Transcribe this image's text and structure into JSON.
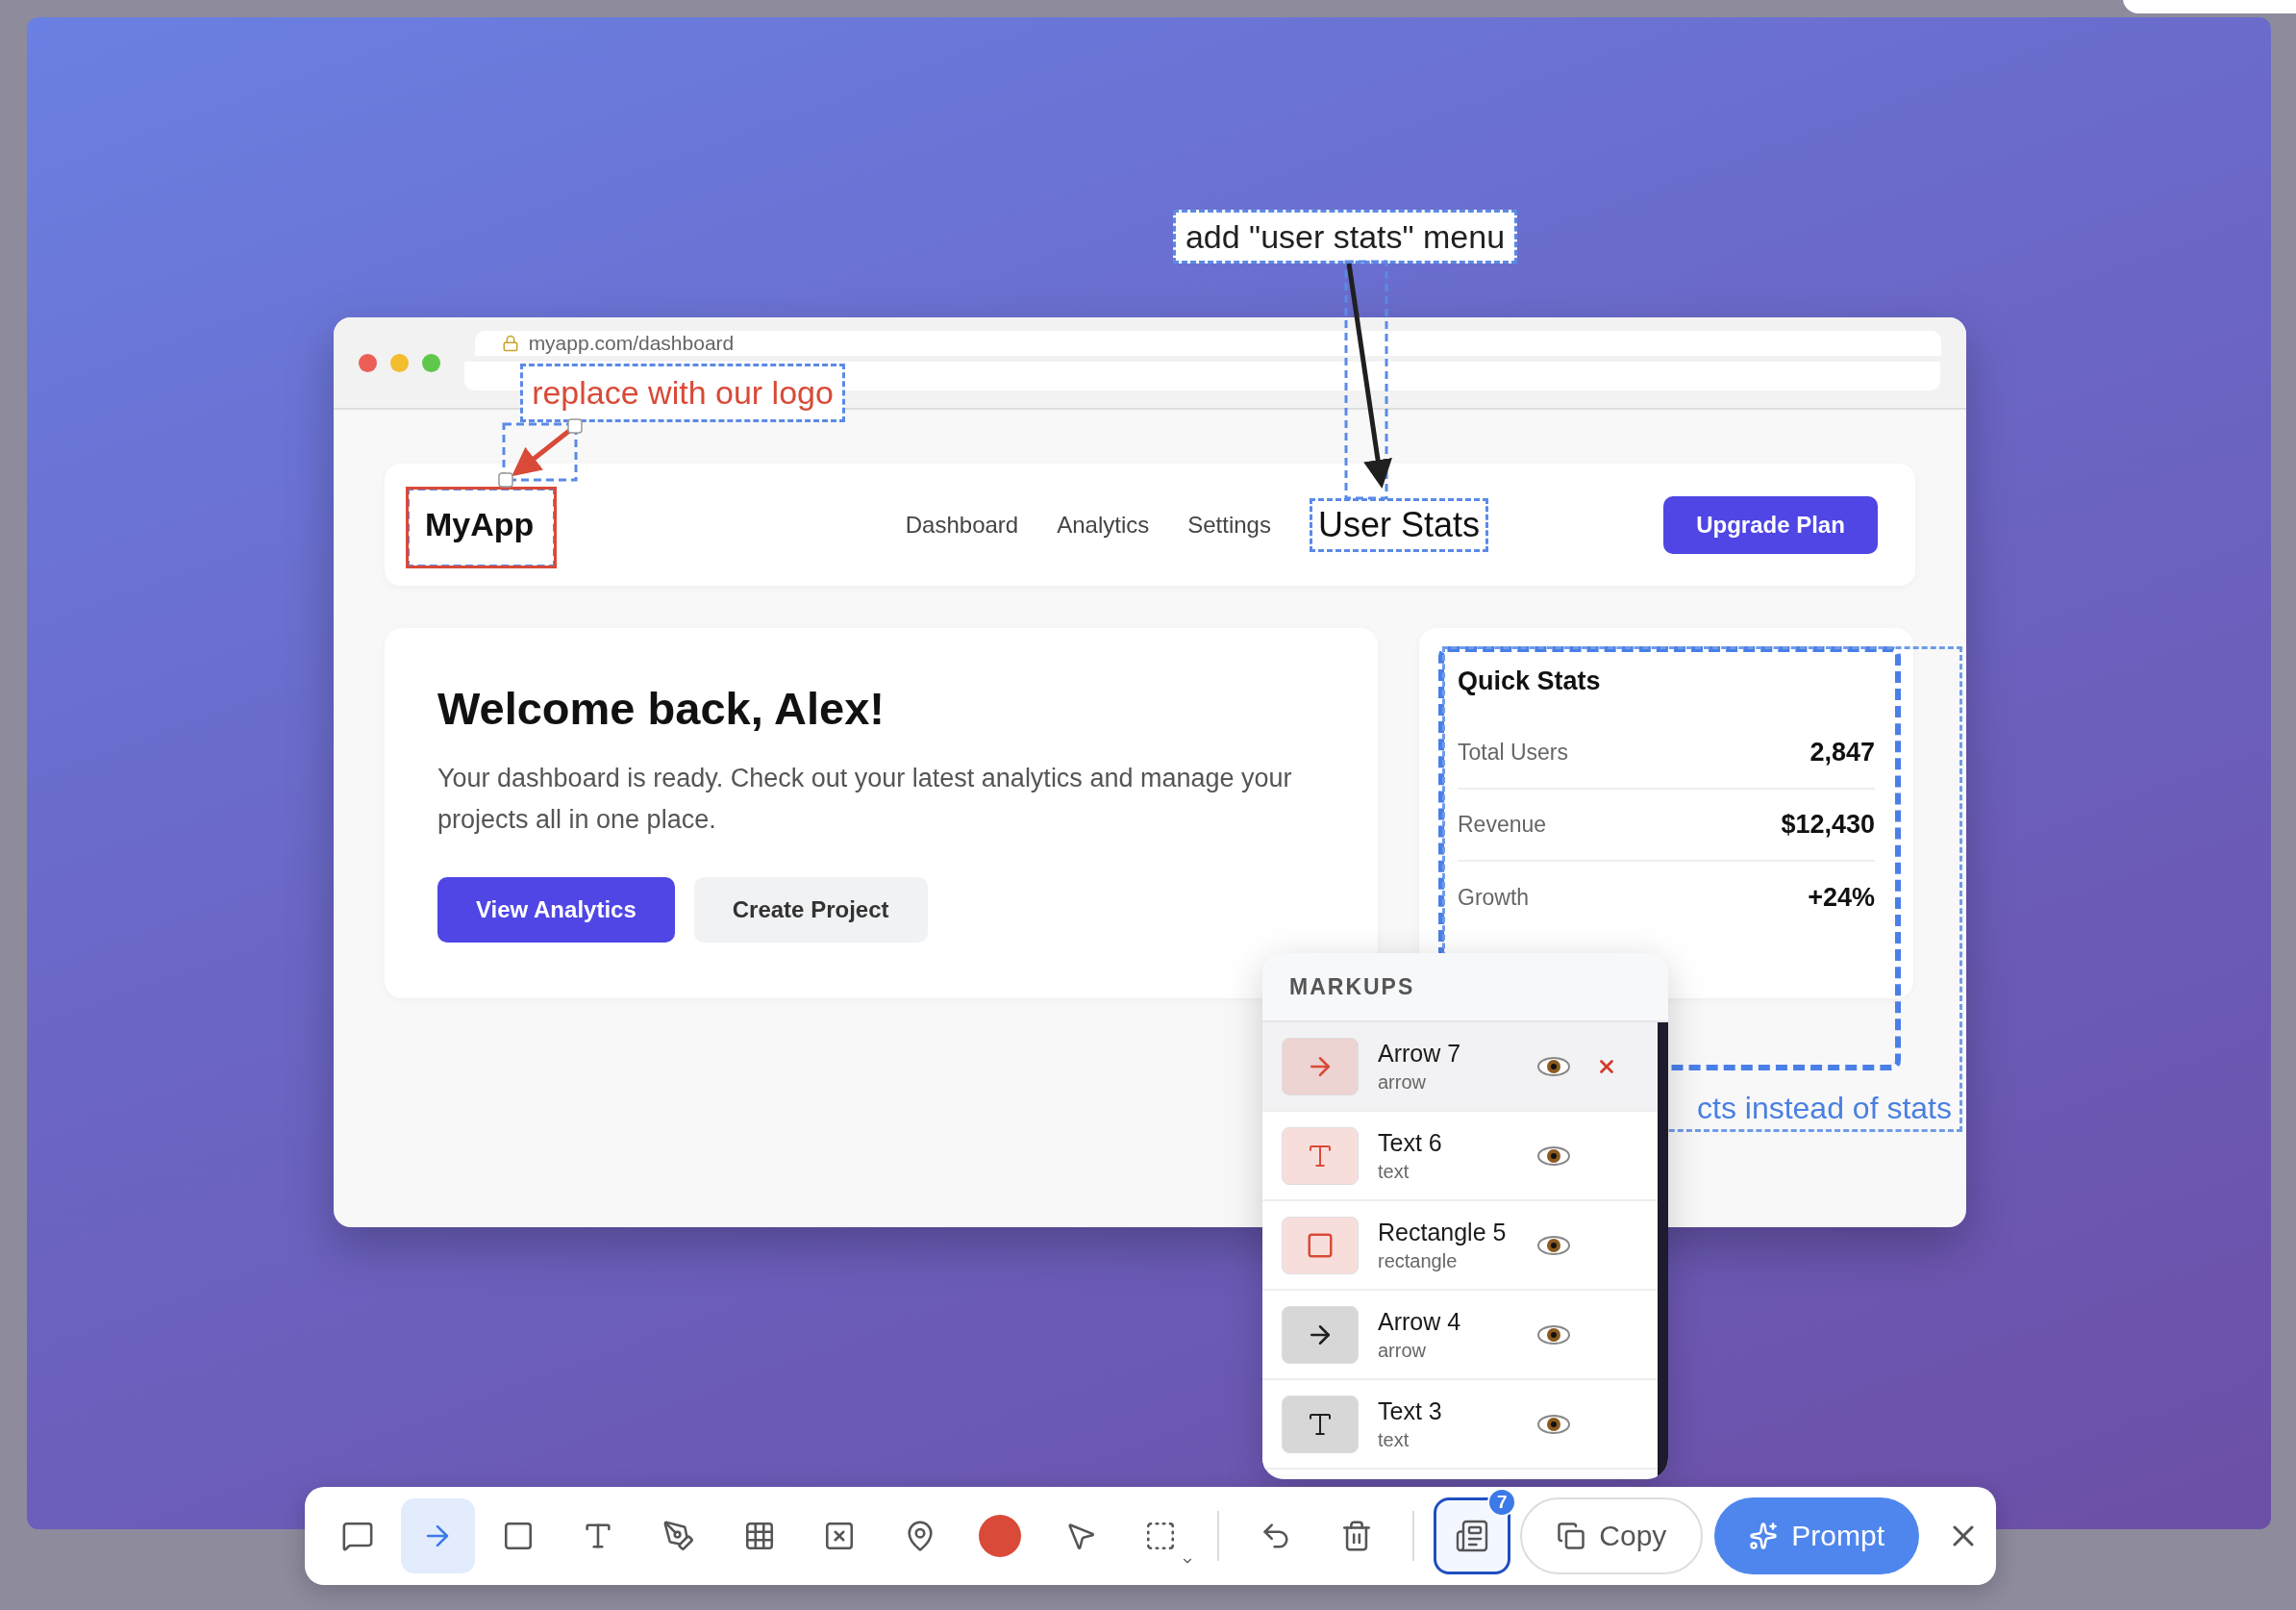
{
  "browser": {
    "url": "myapp.com/dashboard"
  },
  "navbar": {
    "logo": "MyApp",
    "links": [
      {
        "label": "Dashboard",
        "kind": "link"
      },
      {
        "label": "Analytics",
        "kind": "link"
      },
      {
        "label": "Settings",
        "kind": "link"
      },
      {
        "label": "User Stats",
        "kind": "markup"
      }
    ],
    "button": "Upgrade Plan"
  },
  "welcome": {
    "title": "Welcome back, Alex!",
    "text": "Your dashboard is ready. Check out your latest analytics and manage your projects all in one place.",
    "buttons": [
      {
        "label": "View Analytics",
        "kind": "primary"
      },
      {
        "label": "Create Project",
        "kind": "secondary"
      }
    ]
  },
  "quick_stats": {
    "title": "Quick Stats",
    "rows": [
      {
        "label": "Total Users",
        "value": "2,847"
      },
      {
        "label": "Revenue",
        "value": "$12,430"
      },
      {
        "label": "Growth",
        "value": "+24%"
      }
    ]
  },
  "annotations": [
    {
      "kind": "text",
      "text": "add \"user stats\" menu",
      "color": "#1f1f1f"
    },
    {
      "kind": "text",
      "text": "replace with our logo",
      "color": "#d94a38"
    },
    {
      "kind": "text",
      "text": "cts instead of stats",
      "color": "#4a7fe0"
    }
  ],
  "markups": {
    "title": "MARKUPS",
    "items": [
      {
        "name": "Arrow 7",
        "type": "arrow",
        "kind": "arrow",
        "color": "#d94a38",
        "selected": true,
        "visible": true
      },
      {
        "name": "Text 6",
        "type": "text",
        "kind": "text",
        "color": "#d94a38",
        "selected": false,
        "visible": true
      },
      {
        "name": "Rectangle 5",
        "type": "rectangle",
        "kind": "rectangle",
        "color": "#d94a38",
        "selected": false,
        "visible": true
      },
      {
        "name": "Arrow 4",
        "type": "arrow",
        "kind": "arrow",
        "color": "#1f1f1f",
        "selected": false,
        "visible": true
      },
      {
        "name": "Text 3",
        "type": "text",
        "kind": "text",
        "color": "#1f1f1f",
        "selected": false,
        "visible": true
      }
    ]
  },
  "toolbar": {
    "tools": [
      {
        "kind": "comment",
        "selected": false
      },
      {
        "kind": "arrow",
        "selected": true
      },
      {
        "kind": "rectangle",
        "selected": false
      },
      {
        "kind": "text",
        "selected": false
      },
      {
        "kind": "pen",
        "selected": false
      },
      {
        "kind": "grid",
        "selected": false
      },
      {
        "kind": "blur",
        "selected": false
      },
      {
        "kind": "pin",
        "selected": false
      },
      {
        "kind": "color",
        "selected": false
      },
      {
        "kind": "pointer",
        "selected": false
      },
      {
        "kind": "area",
        "selected": false
      },
      {
        "kind": "divider"
      },
      {
        "kind": "undo",
        "selected": false
      },
      {
        "kind": "delete",
        "selected": false
      },
      {
        "kind": "divider"
      }
    ],
    "color": "#d94a38",
    "markups_badge": "7",
    "markups_open": true,
    "copy": "Copy",
    "prompt": "Prompt"
  }
}
